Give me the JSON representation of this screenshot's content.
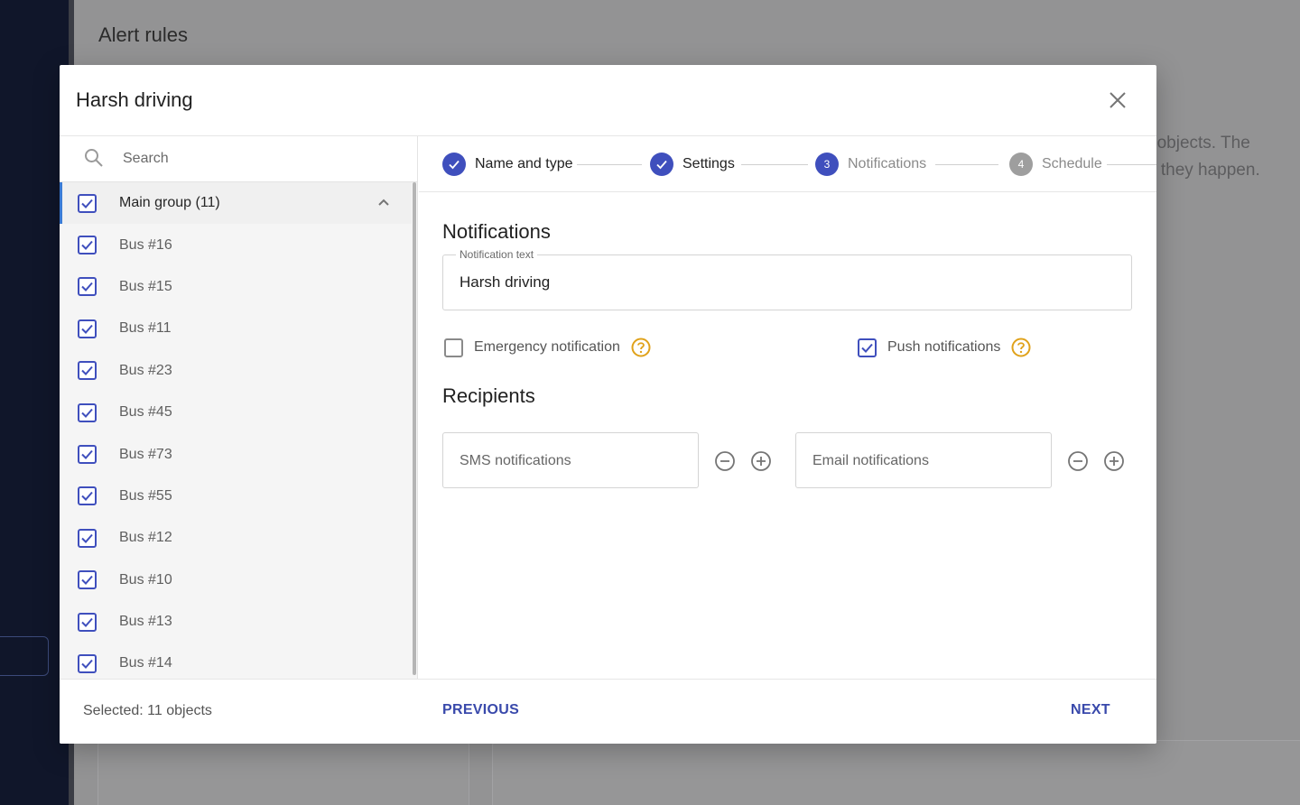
{
  "background": {
    "page_title": "Alert rules",
    "text_line_1": "r objects. The",
    "text_line_2": "e they happen."
  },
  "modal": {
    "title": "Harsh driving",
    "search_placeholder": "Search",
    "group": {
      "label": "Main group (11)",
      "checked": true,
      "expanded": true
    },
    "objects": [
      {
        "label": "Bus #16",
        "checked": true
      },
      {
        "label": "Bus #15",
        "checked": true
      },
      {
        "label": "Bus #11",
        "checked": true
      },
      {
        "label": "Bus #23",
        "checked": true
      },
      {
        "label": "Bus #45",
        "checked": true
      },
      {
        "label": "Bus #73",
        "checked": true
      },
      {
        "label": "Bus #55",
        "checked": true
      },
      {
        "label": "Bus #12",
        "checked": true
      },
      {
        "label": "Bus #10",
        "checked": true
      },
      {
        "label": "Bus #13",
        "checked": true
      },
      {
        "label": "Bus #14",
        "checked": true
      }
    ],
    "steps": [
      {
        "label": "Name and type",
        "state": "done"
      },
      {
        "label": "Settings",
        "state": "done"
      },
      {
        "label": "Notifications",
        "number": "3",
        "state": "active"
      },
      {
        "label": "Schedule",
        "number": "4",
        "state": "pending"
      }
    ],
    "notifications": {
      "heading": "Notifications",
      "text_label": "Notification text",
      "text_value": "Harsh driving",
      "emergency_label": "Emergency notification",
      "emergency_checked": false,
      "push_label": "Push notifications",
      "push_checked": true
    },
    "recipients": {
      "heading": "Recipients",
      "sms_placeholder": "SMS notifications",
      "email_placeholder": "Email notifications"
    },
    "footer": {
      "selected": "Selected: 11 objects",
      "previous": "PREVIOUS",
      "next": "NEXT"
    }
  },
  "colors": {
    "accent": "#3f4fbd",
    "help": "#e0a21b",
    "sidebar": "#10162a"
  }
}
